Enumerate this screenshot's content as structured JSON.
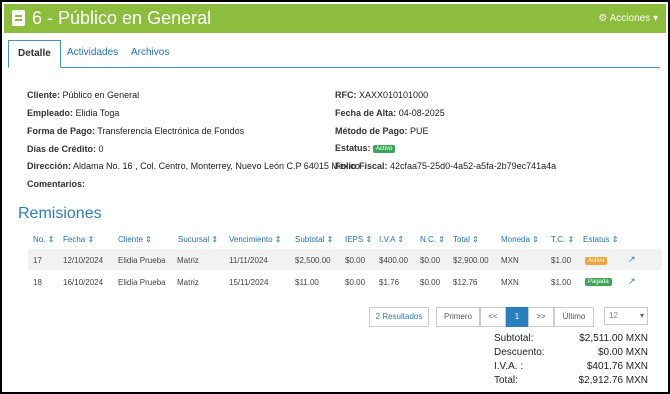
{
  "header": {
    "title": "6 - Público en General",
    "actions_label": "Acciones"
  },
  "tabs": [
    {
      "label": "Detalle"
    },
    {
      "label": "Actividades"
    },
    {
      "label": "Archivos"
    }
  ],
  "details": {
    "cliente_label": "Cliente:",
    "cliente_value": "Público en General",
    "empleado_label": "Empleado:",
    "empleado_value": "Elidia Toga",
    "forma_pago_label": "Forma de Pago:",
    "forma_pago_value": "Transferencia Electrónica de Fondos",
    "dias_credito_label": "Días de Crédito:",
    "dias_credito_value": "0",
    "direccion_label": "Dirección:",
    "direccion_value": "Aldama No. 16 , Col. Centro, Monterrey, Nuevo León C.P 64015 México",
    "comentarios_label": "Comentarios:",
    "comentarios_value": "",
    "rfc_label": "RFC:",
    "rfc_value": "XAXX010101000",
    "fecha_alta_label": "Fecha de Alta:",
    "fecha_alta_value": "04-08-2025",
    "metodo_pago_label": "Método de Pago:",
    "metodo_pago_value": "PUE",
    "estatus_label": "Estatus:",
    "estatus_value": "Activo",
    "folio_label": "Folio Fiscal:",
    "folio_value": "42cfaa75-25d0-4a52-a5fa-2b79ec741a4a"
  },
  "remisiones": {
    "title": "Remisiones",
    "columns": [
      "No.",
      "Fecha",
      "Cliente",
      "Sucursal",
      "Vencimiento",
      "Subtotal",
      "IEPS",
      "I.V.A",
      "N.C.",
      "Total",
      "Moneda",
      "T.C.",
      "Estatus"
    ],
    "rows": [
      {
        "no": "17",
        "fecha": "12/10/2024",
        "cliente": "Elidia Prueba",
        "sucursal": "Matriz",
        "vencimiento": "11/11/2024",
        "subtotal": "$2,500.00",
        "ieps": "$0.00",
        "iva": "$400.00",
        "nc": "$0.00",
        "total": "$2,900.00",
        "moneda": "MXN",
        "tc": "$1.00",
        "estatus": "Activa"
      },
      {
        "no": "18",
        "fecha": "16/10/2024",
        "cliente": "Elidia Prueba",
        "sucursal": "Matriz",
        "vencimiento": "15/11/2024",
        "subtotal": "$11.00",
        "ieps": "$0.00",
        "iva": "$1.76",
        "nc": "$0.00",
        "total": "$12.76",
        "moneda": "MXN",
        "tc": "$1.00",
        "estatus": "Pagada"
      }
    ],
    "results_label": "2 Resultados",
    "pagination": {
      "first": "Primero",
      "prev": "<<",
      "current": "1",
      "next": ">>",
      "last": "Último"
    },
    "page_size": "12"
  },
  "totals": {
    "subtotal_label": "Subtotal:",
    "subtotal_value": "$2,511.00 MXN",
    "descuento_label": "Descuento:",
    "descuento_value": "$0.00 MXN",
    "iva_label": "I.V.A. :",
    "iva_value": "$401.76 MXN",
    "total_label": "Total:",
    "total_value": "$2,912.76 MXN"
  },
  "colors": {
    "header_green": "#8cbd3c",
    "accent_blue": "#2a7fbf",
    "status_active_green": "#3aa757",
    "status_orange": "#f0a43a"
  }
}
